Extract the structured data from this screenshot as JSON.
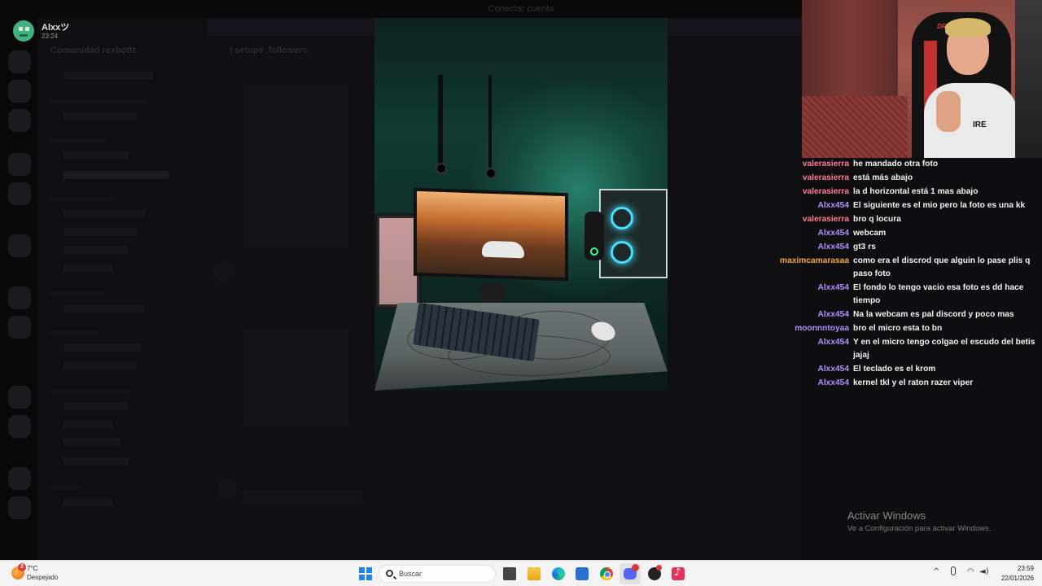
{
  "discord_background": {
    "window_title": "Conectar cuenta",
    "server_name": "Comunidad rexbottt",
    "channel_title": "| setups_followers"
  },
  "streamer": {
    "name": "Alxxツ",
    "time": "23:24"
  },
  "webcam": {
    "chair_brand": "DRIFT",
    "shirt_print": "IRE"
  },
  "chat": {
    "messages": [
      {
        "user": "valerasierra",
        "text": "he mandado otra foto",
        "color": "#ff7d8e"
      },
      {
        "user": "valerasierra",
        "text": "está más abajo",
        "color": "#ff7d8e"
      },
      {
        "user": "valerasierra",
        "text": "la d horizontal está 1 mas abajo",
        "color": "#ff7d8e"
      },
      {
        "user": "Alxx454",
        "text": "El siguiente es el mio pero la foto es una kk",
        "color": "#b68cff"
      },
      {
        "user": "valerasierra",
        "text": "bro q locura",
        "color": "#ff7d8e"
      },
      {
        "user": "Alxx454",
        "text": "webcam",
        "color": "#b68cff"
      },
      {
        "user": "Alxx454",
        "text": "gt3 rs",
        "color": "#b68cff"
      },
      {
        "user": "maximcamarasaa",
        "text": "como era el discrod que alguin lo pase plis q paso foto",
        "color": "#f4a740"
      },
      {
        "user": "Alxx454",
        "text": "El fondo lo tengo vacio esa foto es dd hace tiempo",
        "color": "#b68cff"
      },
      {
        "user": "Alxx454",
        "text": "Na la webcam es pal discord y poco mas",
        "color": "#b68cff"
      },
      {
        "user": "moonnntoyaa",
        "text": "bro el micro esta to bn",
        "color": "#b68cff"
      },
      {
        "user": "Alxx454",
        "text": "Y en el micro tengo colgao el escudo del betis jajaj",
        "color": "#b68cff"
      },
      {
        "user": "Alxx454",
        "text": "El teclado es el krom",
        "color": "#b68cff"
      },
      {
        "user": "Alxx454",
        "text": "kernel tkl y el raton razer viper",
        "color": "#b68cff"
      }
    ]
  },
  "activation": {
    "title": "Activar Windows",
    "subtitle": "Ve a Configuración para activar Windows."
  },
  "taskbar": {
    "weather_temp": "7°C",
    "weather_desc": "Despejado",
    "weather_badge": "2",
    "search_placeholder": "Buscar",
    "clock_time": "23:59",
    "clock_date": "22/01/2026",
    "icons": [
      "windows-start",
      "search",
      "task-view",
      "file-explorer",
      "edge",
      "microsoft-store",
      "chrome",
      "discord",
      "obs",
      "tiktok"
    ]
  }
}
